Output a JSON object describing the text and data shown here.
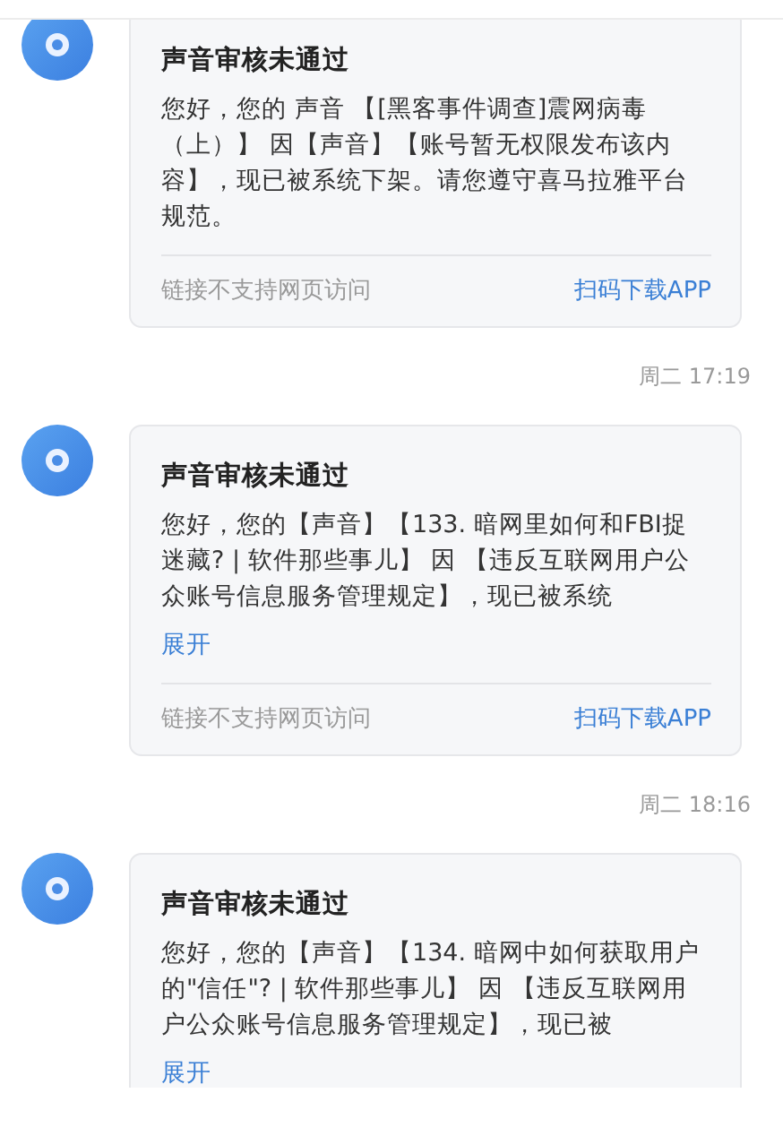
{
  "messages": [
    {
      "title": "声音审核未通过",
      "body": "您好，您的 声音 【[黑客事件调查]震网病毒（上）】 因【声音】【账号暂无权限发布该内容】，现已被系统下架。请您遵守喜马拉雅平台规范。",
      "footer": {
        "note": "链接不支持网页访问",
        "link": "扫码下载APP"
      }
    },
    {
      "time": "周二 17:19",
      "title": "声音审核未通过",
      "body": "您好，您的【声音】【133. 暗网里如何和FBI捉迷藏? | 软件那些事儿】 因 【违反互联网用户公众账号信息服务管理规定】，现已被系统",
      "expand": "展开",
      "footer": {
        "note": "链接不支持网页访问",
        "link": "扫码下载APP"
      }
    },
    {
      "time": "周二 18:16",
      "title": "声音审核未通过",
      "body": "您好，您的【声音】【134. 暗网中如何获取用户的\"信任\"? | 软件那些事儿】 因 【违反互联网用户公众账号信息服务管理规定】，现已被",
      "expand": "展开"
    }
  ]
}
